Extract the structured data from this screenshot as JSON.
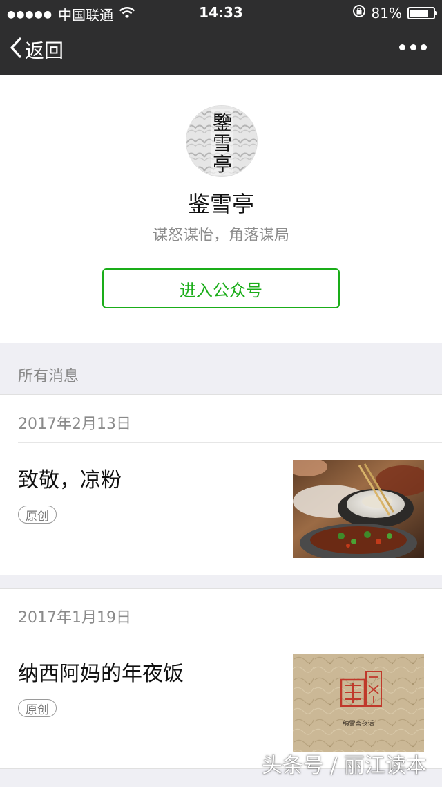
{
  "status_bar": {
    "signal_dots": "●●●●●",
    "carrier": "中国联通",
    "time": "14:33",
    "battery_percent": "81%",
    "battery_level": 0.81
  },
  "nav": {
    "back_label": "返回"
  },
  "profile": {
    "avatar_text": "鑒雪亭",
    "name": "鉴雪亭",
    "description": "谋怒谋怡，角落谋局",
    "enter_button": "进入公众号"
  },
  "messages": {
    "section_title": "所有消息",
    "items": [
      {
        "date": "2017年2月13日",
        "title": "致敬，凉粉",
        "tag": "原创"
      },
      {
        "date": "2017年1月19日",
        "title": "纳西阿妈的年夜饭",
        "tag": "原创",
        "thumb_caption": "纳雪斋夜话"
      }
    ]
  },
  "watermark": "头条号 / 丽江读本",
  "colors": {
    "nav_bg": "#2e2e2f",
    "accent_green": "#1aad19",
    "page_bg": "#efeff4"
  }
}
